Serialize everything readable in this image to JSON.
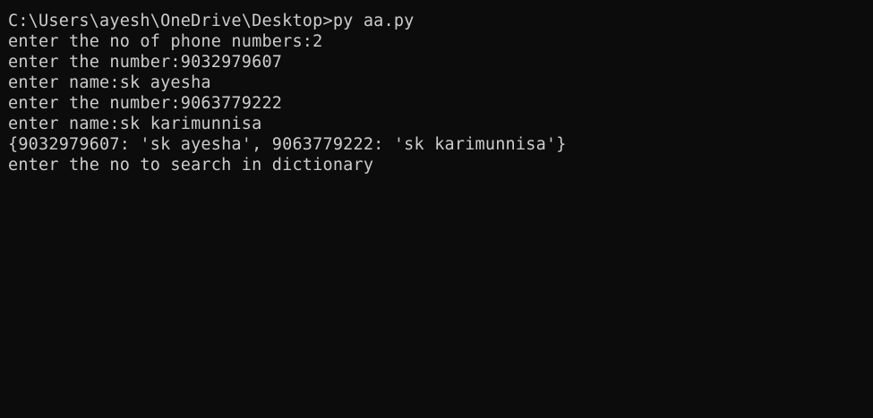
{
  "terminal": {
    "lines": [
      "C:\\Users\\ayesh\\OneDrive\\Desktop>py aa.py",
      "enter the no of phone numbers:2",
      "enter the number:9032979607",
      "enter name:sk ayesha",
      "enter the number:9063779222",
      "enter name:sk karimunnisa",
      "{9032979607: 'sk ayesha', 9063779222: 'sk karimunnisa'}",
      "enter the no to search in dictionary"
    ],
    "colors": {
      "background": "#0c0c0c",
      "text": "#cccccc"
    }
  }
}
